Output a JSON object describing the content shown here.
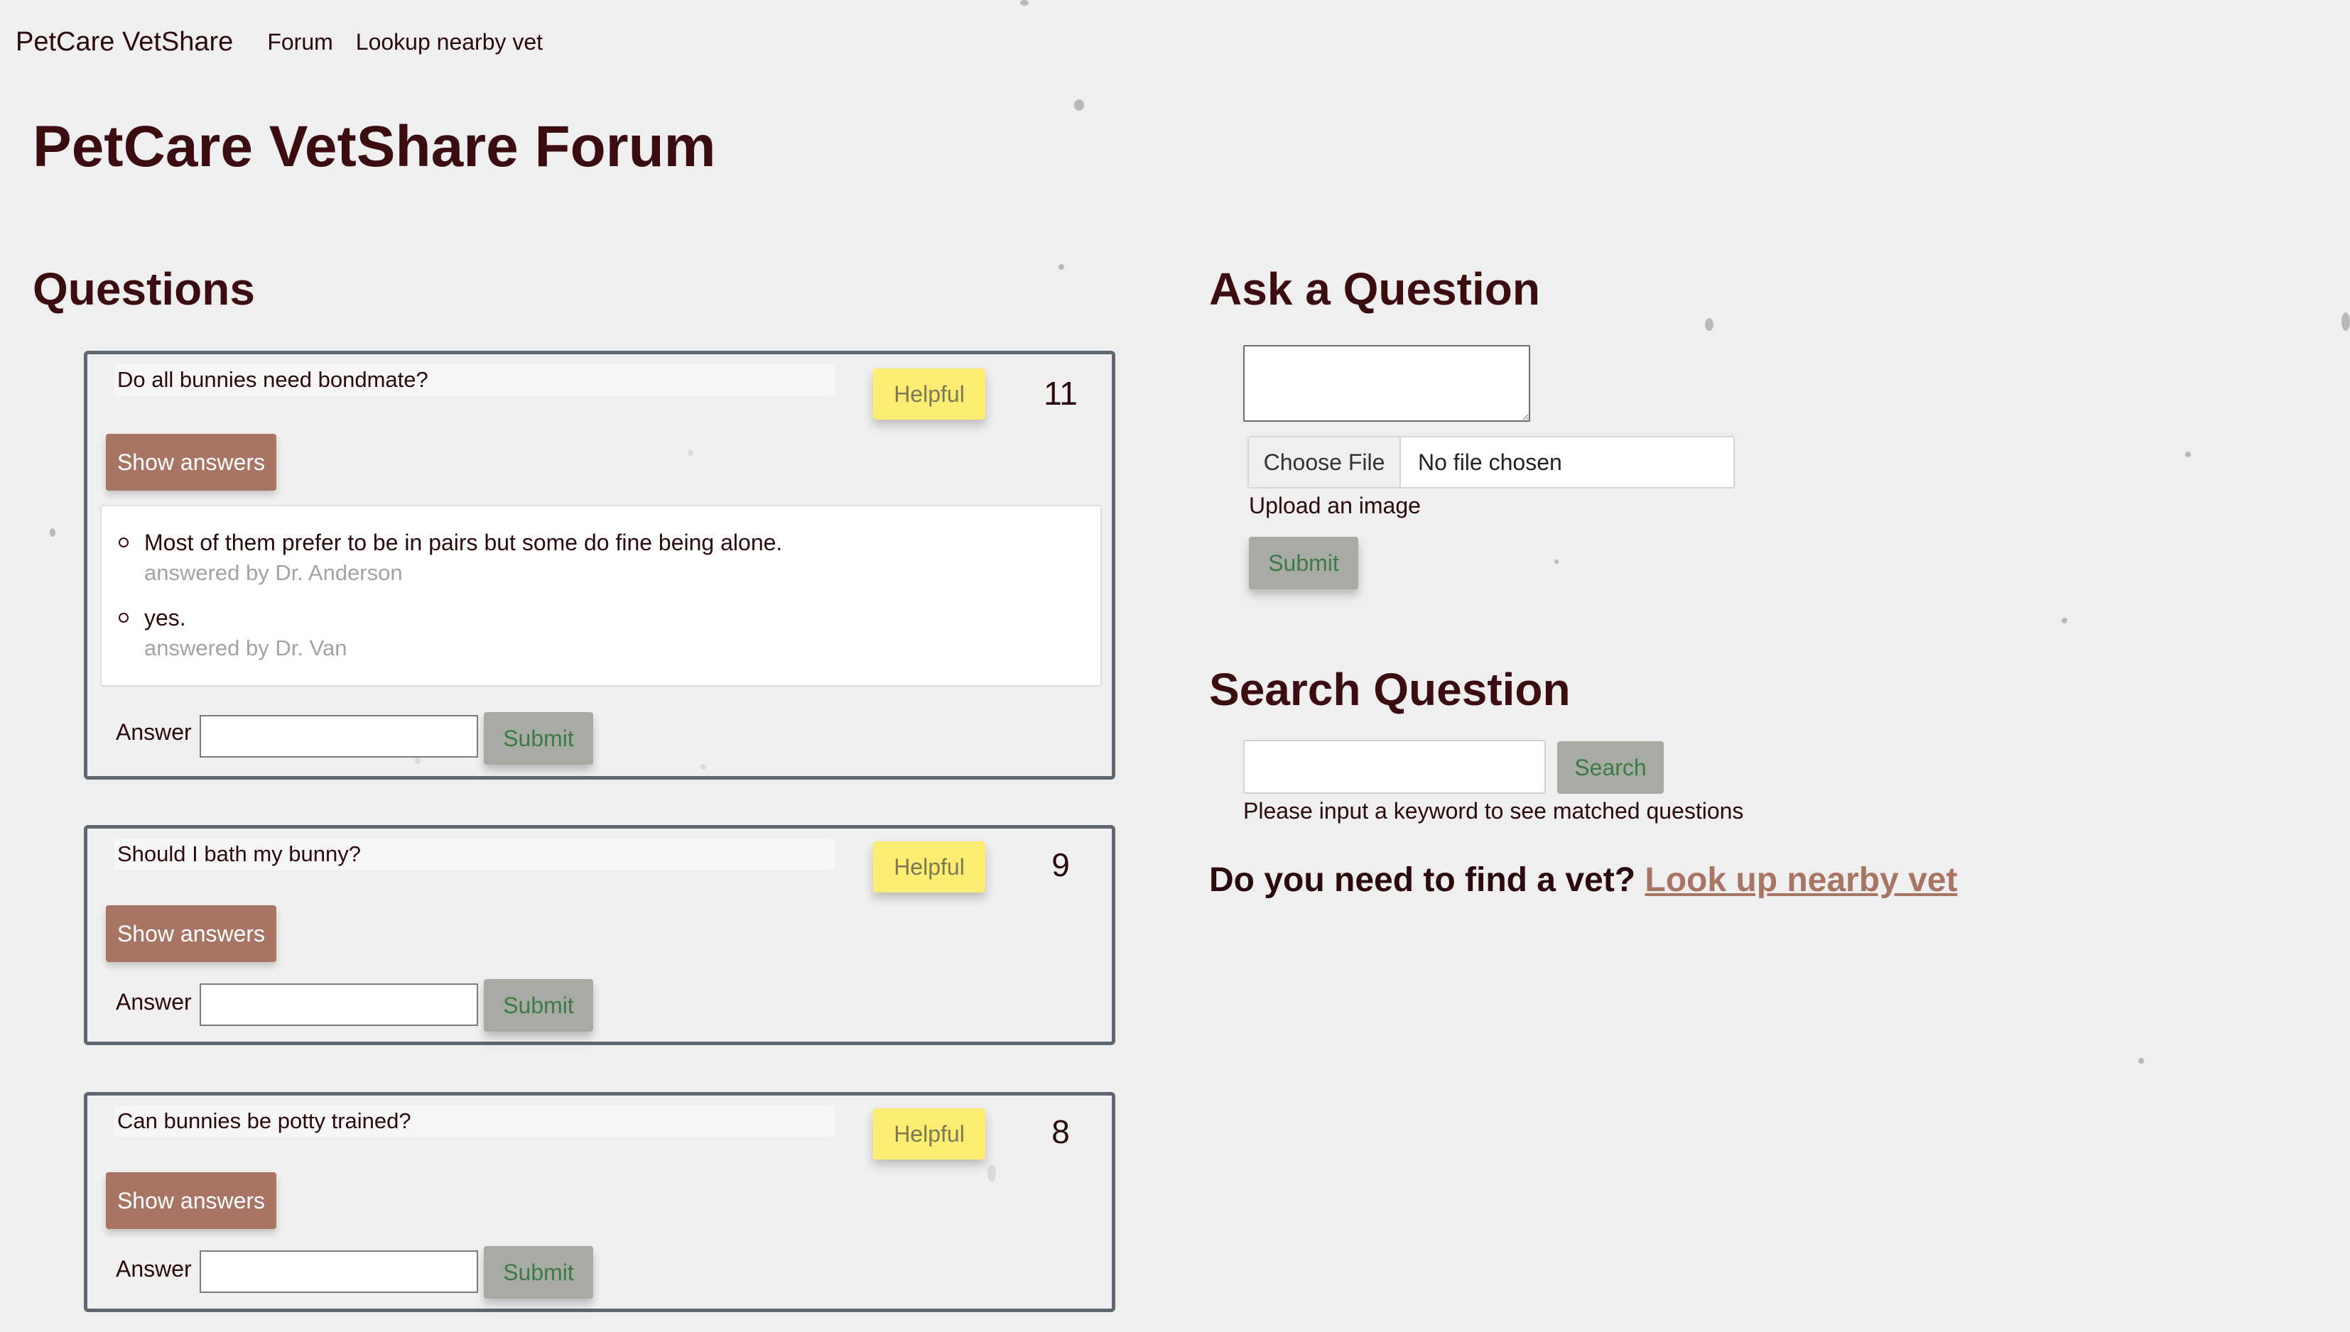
{
  "nav": {
    "brand": "PetCare VetShare",
    "links": [
      "Forum",
      "Lookup nearby vet"
    ]
  },
  "page_title": "PetCare VetShare Forum",
  "questions_section": {
    "heading": "Questions",
    "helpful_label": "Helpful",
    "show_answers_label": "Show answers",
    "answer_label": "Answer",
    "submit_label": "Submit",
    "items": [
      {
        "question": "Do all bunnies need bondmate?",
        "count": "11",
        "answers": [
          {
            "text": "Most of them prefer to be in pairs but some do fine being alone.",
            "by": "answered by Dr. Anderson"
          },
          {
            "text": "yes.",
            "by": "answered by Dr. Van"
          }
        ]
      },
      {
        "question": "Should I bath my bunny?",
        "count": "9"
      },
      {
        "question": "Can bunnies be potty trained?",
        "count": "8"
      }
    ]
  },
  "ask_section": {
    "heading": "Ask a Question",
    "choose_file_label": "Choose File",
    "file_status": "No file chosen",
    "upload_label": "Upload an image",
    "submit_label": "Submit"
  },
  "search_section": {
    "heading": "Search Question",
    "button_label": "Search",
    "hint": "Please input a keyword to see matched questions"
  },
  "find_vet": {
    "prompt": "Do you need to find a vet?",
    "link_text": "Look up nearby vet"
  },
  "colors": {
    "heading": "#3b0d10",
    "show_answers_bg": "#a87565",
    "helpful_bg": "#fcec72",
    "submit_bg": "#a8aba4",
    "submit_text": "#3d7a48",
    "card_border": "#5f6770"
  }
}
